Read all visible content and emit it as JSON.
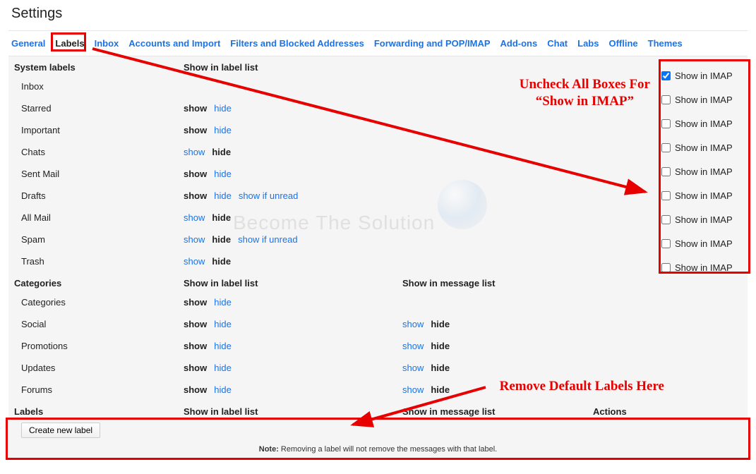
{
  "page_title": "Settings",
  "tabs": [
    {
      "id": "general",
      "label": "General",
      "active": false
    },
    {
      "id": "labels",
      "label": "Labels",
      "active": true
    },
    {
      "id": "inbox",
      "label": "Inbox",
      "active": false
    },
    {
      "id": "accounts",
      "label": "Accounts and Import",
      "active": false
    },
    {
      "id": "filters",
      "label": "Filters and Blocked Addresses",
      "active": false
    },
    {
      "id": "forwarding",
      "label": "Forwarding and POP/IMAP",
      "active": false
    },
    {
      "id": "addons",
      "label": "Add-ons",
      "active": false
    },
    {
      "id": "chat",
      "label": "Chat",
      "active": false
    },
    {
      "id": "labs",
      "label": "Labs",
      "active": false
    },
    {
      "id": "offline",
      "label": "Offline",
      "active": false
    },
    {
      "id": "themes",
      "label": "Themes",
      "active": false
    }
  ],
  "headers": {
    "system_labels": "System labels",
    "show_in_label_list": "Show in label list",
    "categories": "Categories",
    "show_in_msg_list": "Show in message list",
    "labels": "Labels",
    "actions": "Actions"
  },
  "common": {
    "show": "show",
    "hide": "hide",
    "show_if_unread": "show if unread",
    "show_in_imap": "Show in IMAP",
    "create_new_label": "Create new label"
  },
  "system_labels": [
    {
      "name": "Inbox",
      "labellist": null,
      "imap_checked": true
    },
    {
      "name": "Starred",
      "labellist": {
        "active": "show",
        "other": "hide"
      },
      "imap_checked": false
    },
    {
      "name": "Important",
      "labellist": {
        "active": "show",
        "other": "hide"
      },
      "imap_checked": false
    },
    {
      "name": "Chats",
      "labellist": {
        "active": "hide",
        "other": "show"
      },
      "imap_checked": false
    },
    {
      "name": "Sent Mail",
      "labellist": {
        "active": "show",
        "other": "hide"
      },
      "imap_checked": false
    },
    {
      "name": "Drafts",
      "labellist": {
        "active": "show",
        "other": "hide",
        "extra": "show if unread"
      },
      "imap_checked": false
    },
    {
      "name": "All Mail",
      "labellist": {
        "active": "hide",
        "other": "show"
      },
      "imap_checked": false
    },
    {
      "name": "Spam",
      "labellist": {
        "active": "hide",
        "other": "show",
        "extra": "show if unread"
      },
      "imap_checked": false
    },
    {
      "name": "Trash",
      "labellist": {
        "active": "hide",
        "other": "show"
      },
      "imap_checked": false
    }
  ],
  "categories": [
    {
      "name": "Categories",
      "labellist": {
        "active": "show",
        "other": "hide"
      },
      "msglist": null
    },
    {
      "name": "Social",
      "labellist": {
        "active": "show",
        "other": "hide"
      },
      "msglist": {
        "active": "hide",
        "other": "show"
      }
    },
    {
      "name": "Promotions",
      "labellist": {
        "active": "show",
        "other": "hide"
      },
      "msglist": {
        "active": "hide",
        "other": "show"
      }
    },
    {
      "name": "Updates",
      "labellist": {
        "active": "show",
        "other": "hide"
      },
      "msglist": {
        "active": "hide",
        "other": "show"
      }
    },
    {
      "name": "Forums",
      "labellist": {
        "active": "show",
        "other": "hide"
      },
      "msglist": {
        "active": "hide",
        "other": "show"
      }
    }
  ],
  "note_prefix": "Note:",
  "note_text": " Removing a label will not remove the messages with that label.",
  "annotations": {
    "uncheck": "Uncheck All Boxes For\n“Show in IMAP”",
    "remove": "Remove Default Labels Here"
  },
  "watermark": "Become The Solution",
  "colors": {
    "annotation": "#e60000",
    "link": "#1a73e8"
  }
}
